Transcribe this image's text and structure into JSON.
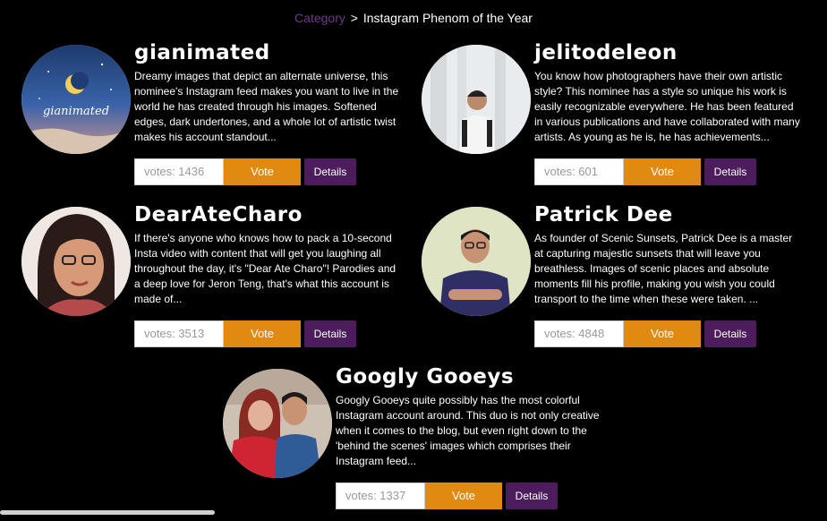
{
  "breadcrumb": {
    "category": "Category",
    "separator": ">",
    "current": "Instagram Phenom of the Year"
  },
  "nominees": [
    {
      "name": "gianimated",
      "description": "Dreamy images that depict an alternate universe, this nominee's Instagram feed makes you want to live in the world he has created through his images. Softened edges, dark undertones, and a whole lot of artistic twist makes his account standout...",
      "votes": "votes: 1436",
      "vote_label": "Vote",
      "details_label": "Details",
      "avatar_text": "gianimated"
    },
    {
      "name": "jelitodeleon",
      "description": "You know how photographers have their own artistic style? This nominee has a style so unique his work is easily recognizable everywhere. He has been featured in various publications and have collaborated with many artists. As young as he is, he has achievements...",
      "votes": "votes: 601",
      "vote_label": "Vote",
      "details_label": "Details"
    },
    {
      "name": "DearAteCharo",
      "description": "If there's anyone who knows how to pack a 10-second Insta video with content that will get you laughing all throughout the day, it's \"Dear Ate Charo\"! Parodies and a deep love for Jeron Teng, that's what this account is made of...",
      "votes": "votes: 3513",
      "vote_label": "Vote",
      "details_label": "Details"
    },
    {
      "name": "Patrick Dee",
      "description": "As founder of Scenic Sunsets, Patrick Dee is a master at capturing majestic sunsets that will leave you breathless. Images of scenic places and absolute moments fill his profile, making you wish you could transport to the time when these were taken. ...",
      "votes": "votes: 4848",
      "vote_label": "Vote",
      "details_label": "Details"
    },
    {
      "name": "Googly Gooeys",
      "description": "Googly Gooeys quite possibly has the most colorful Instagram account around. This duo is not only creative when it comes to the blog, but even right down to the 'behind the scenes' images which comprises their Instagram feed...",
      "votes": "votes: 1337",
      "vote_label": "Vote",
      "details_label": "Details"
    }
  ],
  "colors": {
    "background": "#000000",
    "vote_button": "#e08a12",
    "details_button": "#4c1c5c",
    "breadcrumb_link": "#6d3a8a"
  }
}
